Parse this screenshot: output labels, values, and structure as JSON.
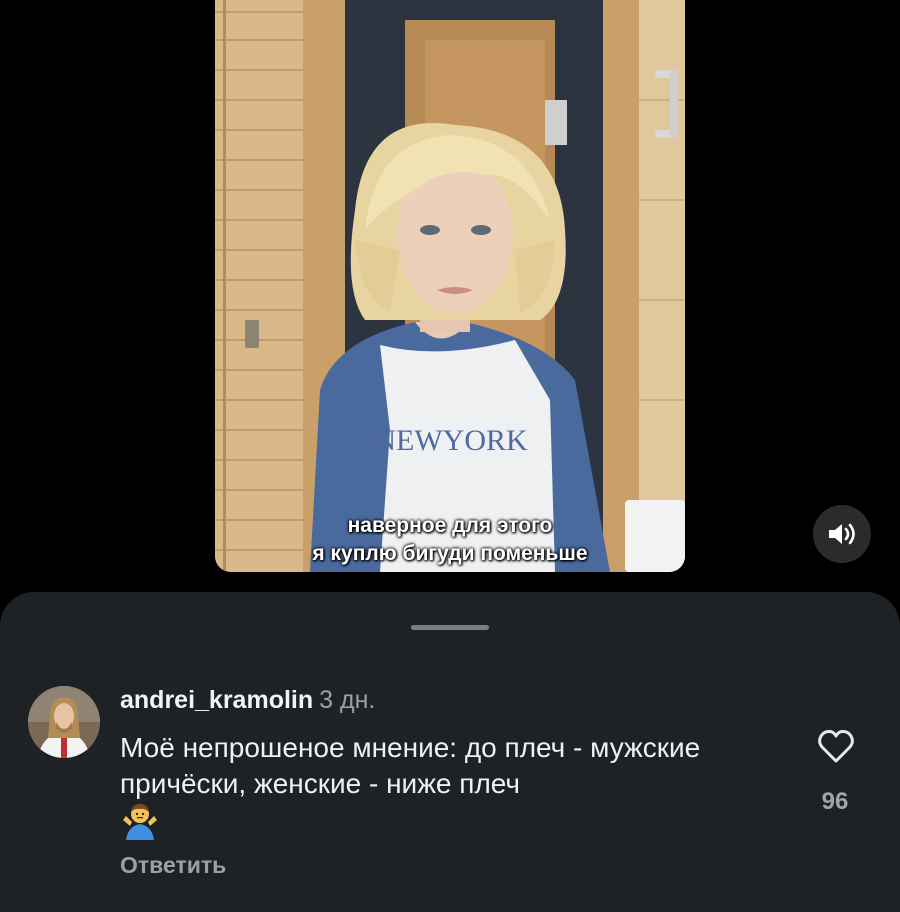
{
  "video": {
    "caption_lines": [
      "наверное для этого",
      "я куплю бигуди поменьше"
    ],
    "sound_icon": "speaker-icon"
  },
  "comments_sheet": {
    "comment": {
      "username": "andrei_kramolin",
      "time": "3 дн.",
      "text": "Моё непрошеное мнение: до плеч - мужские причёски, женские - ниже плеч",
      "emoji": "man-shrugging-emoji",
      "like_icon": "heart-outline-icon",
      "like_count": "96",
      "reply_label": "Ответить"
    }
  },
  "colors": {
    "background": "#000000",
    "sheet": "#1f2225",
    "text": "#eef0f2",
    "muted": "#9aa0a6"
  }
}
